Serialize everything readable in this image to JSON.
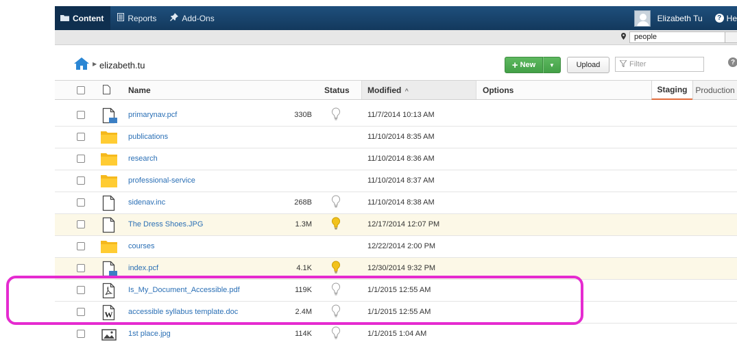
{
  "nav": {
    "tabs": [
      {
        "label": "Content",
        "icon": "folder-icon",
        "active": true
      },
      {
        "label": "Reports",
        "icon": "reports-icon",
        "active": false
      },
      {
        "label": "Add-Ons",
        "icon": "pin-icon",
        "active": false
      }
    ],
    "user_name": "Elizabeth Tu",
    "help_label": "He"
  },
  "search": {
    "value": "people"
  },
  "breadcrumb": {
    "current": "elizabeth.tu"
  },
  "toolbar": {
    "new_label": "New",
    "upload_label": "Upload",
    "filter_placeholder": "Filter"
  },
  "table": {
    "headers": {
      "name": "Name",
      "status": "Status",
      "modified": "Modified",
      "modified_sort": "^",
      "options": "Options"
    },
    "environment_tabs": {
      "staging": "Staging",
      "production": "Production"
    },
    "rows": [
      {
        "name": "primarynav.pcf",
        "type": "pcf",
        "size": "330B",
        "status": "off",
        "modified": "11/7/2014 10:13 AM",
        "highlight": false
      },
      {
        "name": "publications",
        "type": "folder",
        "size": "",
        "status": "none",
        "modified": "11/10/2014 8:35 AM",
        "highlight": false
      },
      {
        "name": "research",
        "type": "folder",
        "size": "",
        "status": "none",
        "modified": "11/10/2014 8:36 AM",
        "highlight": false
      },
      {
        "name": "professional-service",
        "type": "folder",
        "size": "",
        "status": "none",
        "modified": "11/10/2014 8:37 AM",
        "highlight": false
      },
      {
        "name": "sidenav.inc",
        "type": "file",
        "size": "268B",
        "status": "off",
        "modified": "11/10/2014 8:38 AM",
        "highlight": false
      },
      {
        "name": "The Dress Shoes.JPG",
        "type": "file",
        "size": "1.3M",
        "status": "on",
        "modified": "12/17/2014 12:07 PM",
        "highlight": true
      },
      {
        "name": "courses",
        "type": "folder",
        "size": "",
        "status": "none",
        "modified": "12/22/2014 2:00 PM",
        "highlight": false
      },
      {
        "name": "index.pcf",
        "type": "pcf",
        "size": "4.1K",
        "status": "on",
        "modified": "12/30/2014 9:32 PM",
        "highlight": true
      },
      {
        "name": "Is_My_Document_Accessible.pdf",
        "type": "pdf",
        "size": "119K",
        "status": "off",
        "modified": "1/1/2015 12:55 AM",
        "highlight": false
      },
      {
        "name": "accessible syllabus template.doc",
        "type": "doc",
        "size": "2.4M",
        "status": "off",
        "modified": "1/1/2015 12:55 AM",
        "highlight": false
      },
      {
        "name": "1st place.jpg",
        "type": "image",
        "size": "114K",
        "status": "off",
        "modified": "1/1/2015 1:04 AM",
        "highlight": false
      }
    ]
  },
  "colors": {
    "nav_bg": "#1e4f7c",
    "new_button": "#4caf50",
    "link": "#2a6fb5",
    "highlight_row": "#fcf8e7",
    "bulb_on": "#f2c21b",
    "callout": "#e52bd0",
    "staging_underline": "#e06b3b"
  }
}
